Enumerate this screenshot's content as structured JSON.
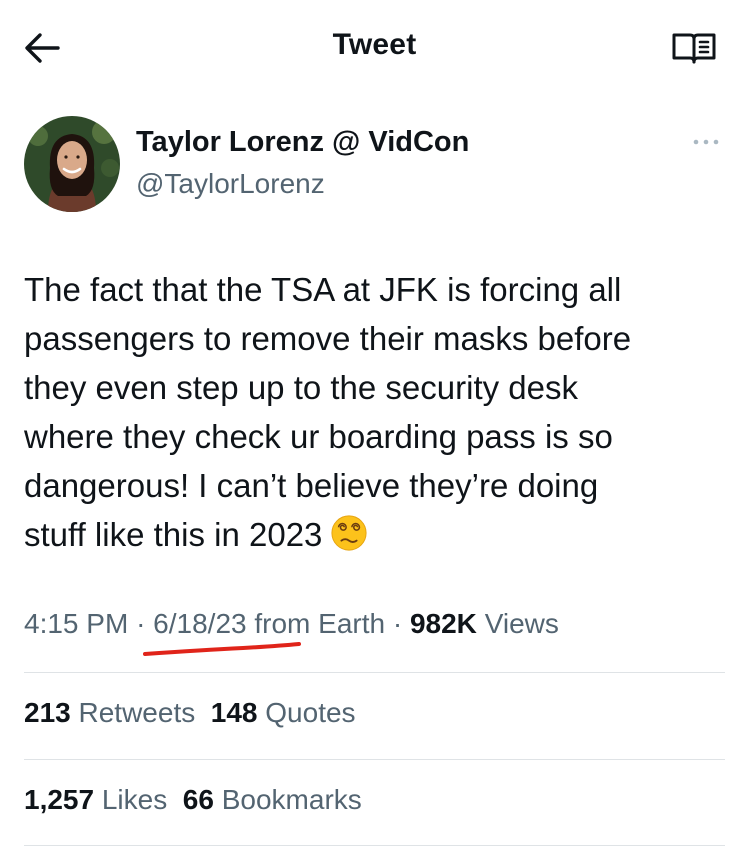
{
  "header": {
    "title": "Tweet",
    "back_icon": "arrow-left-icon",
    "reader_icon": "open-book-icon"
  },
  "author": {
    "name": "Taylor Lorenz @ VidCon",
    "handle": "@TaylorLorenz"
  },
  "tweet": {
    "text": "The fact that the TSA at JFK is forcing all\npassengers to remove their masks before\nthey even step up to the security desk\nwhere they check ur boarding pass is so\ndangerous! I can’t believe they’re doing\nstuff like this in 2023",
    "emoji": "face-with-spiral-eyes-emoji"
  },
  "meta": {
    "time": "4:15 PM",
    "date": "6/18/23",
    "source": "from Earth",
    "separator": "·",
    "views_count": "982K",
    "views_label": "Views"
  },
  "stats": {
    "retweets_count": "213",
    "retweets_label": "Retweets",
    "quotes_count": "148",
    "quotes_label": "Quotes",
    "likes_count": "1,257",
    "likes_label": "Likes",
    "bookmarks_count": "66",
    "bookmarks_label": "Bookmarks"
  },
  "colors": {
    "text": "#0f1419",
    "secondary": "#536471",
    "divider": "#dfe3e6",
    "annotation": "#e0241a"
  }
}
